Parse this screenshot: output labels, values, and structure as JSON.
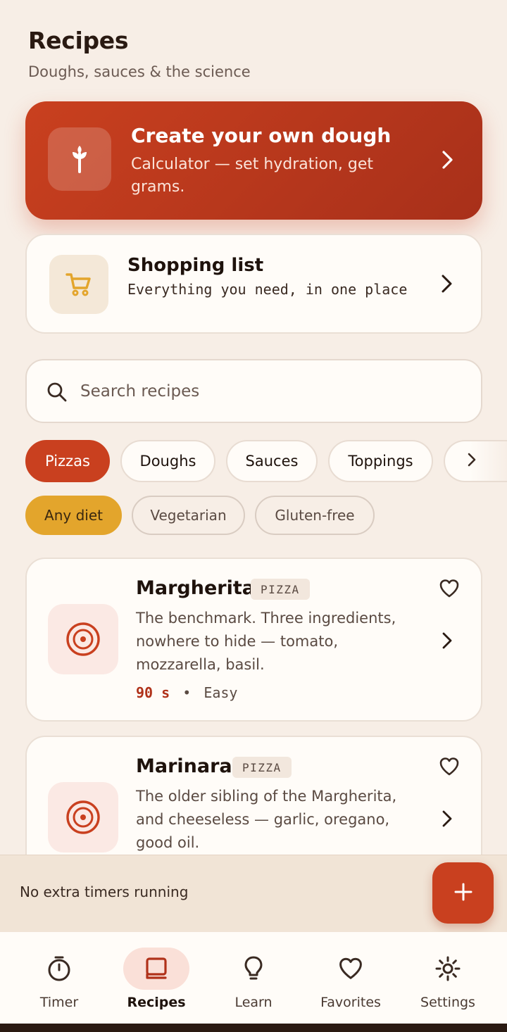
{
  "header": {
    "title": "Recipes",
    "subtitle": "Doughs, sauces & the science"
  },
  "hero": {
    "title": "Create your own dough",
    "description": "Calculator — set hydration, get grams.",
    "icon": "wheat-icon"
  },
  "shopping": {
    "title": "Shopping list",
    "description": "Everything you need, in one place",
    "icon": "cart-icon"
  },
  "search": {
    "placeholder": "Search recipes",
    "value": ""
  },
  "categories": [
    {
      "label": "Pizzas",
      "active": true
    },
    {
      "label": "Doughs",
      "active": false
    },
    {
      "label": "Sauces",
      "active": false
    },
    {
      "label": "Toppings",
      "active": false
    }
  ],
  "diets": [
    {
      "label": "Any diet",
      "active": true
    },
    {
      "label": "Vegetarian",
      "active": false
    },
    {
      "label": "Gluten-free",
      "active": false
    }
  ],
  "recipes": [
    {
      "name": "Margherita",
      "badge": "PIZZA",
      "description": "The benchmark. Three ingredients, nowhere to hide — tomato, mozzarella, basil.",
      "time": "90 s",
      "separator": "•",
      "difficulty": "Easy"
    },
    {
      "name": "Marinara",
      "badge": "PIZZA",
      "description": "The older sibling of the Margherita, and cheeseless — garlic, oregano, good oil."
    }
  ],
  "timers": {
    "status": "No extra timers running",
    "fab_icon": "plus-icon"
  },
  "nav": [
    {
      "label": "Timer",
      "icon": "stopwatch-icon",
      "active": false
    },
    {
      "label": "Recipes",
      "icon": "book-icon",
      "active": true
    },
    {
      "label": "Learn",
      "icon": "lightbulb-icon",
      "active": false
    },
    {
      "label": "Favorites",
      "icon": "heart-icon",
      "active": false
    },
    {
      "label": "Settings",
      "icon": "gear-icon",
      "active": false
    }
  ],
  "colors": {
    "accent": "#C9401F",
    "diet_active": "#E3A52C",
    "background": "#F7EEE6",
    "card": "#FFFCF8"
  }
}
